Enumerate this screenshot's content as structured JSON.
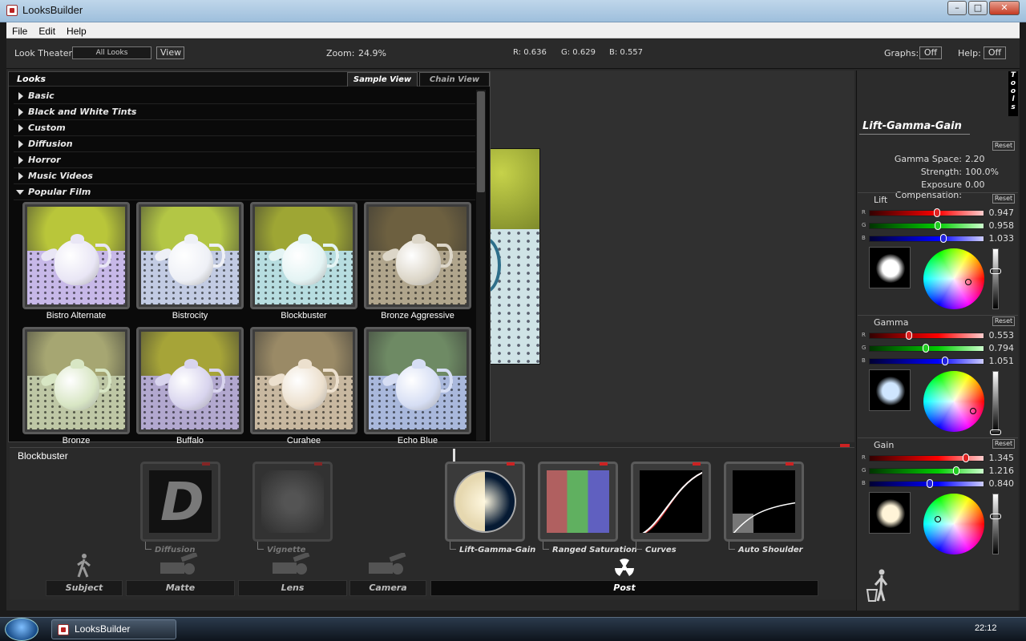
{
  "window": {
    "title": "LooksBuilder",
    "min": "–",
    "max": "□",
    "close": "✕"
  },
  "menu": [
    "File",
    "Edit",
    "Help"
  ],
  "toolbar": {
    "look_theater_label": "Look Theater:",
    "look_theater_value": "All Looks",
    "view_button": "View",
    "zoom_label": "Zoom:",
    "zoom_value": "24.9%",
    "r_readout": "R: 0.636",
    "g_readout": "G: 0.629",
    "b_readout": "B: 0.557",
    "graphs_label": "Graphs:",
    "graphs_value": "Off",
    "help_label": "Help:",
    "help_value": "Off"
  },
  "looks": {
    "title": "Looks",
    "tabs": [
      "Sample View",
      "Chain View"
    ],
    "categories": [
      "Basic",
      "Black and White Tints",
      "Custom",
      "Diffusion",
      "Horror",
      "Music Videos",
      "Popular Film"
    ],
    "thumbnails": [
      {
        "label": "Bistro Alternate",
        "wall": "#b9c63a",
        "table": "#c7b8e8",
        "pot": "#e9e6f5",
        "dots": "#5a4a6a"
      },
      {
        "label": "Bistrocity",
        "wall": "#b3c645",
        "table": "#c2cbe3",
        "pot": "#eef0f6",
        "dots": "#4a4a5a"
      },
      {
        "label": "Blockbuster",
        "wall": "#9ea634",
        "table": "#b7dde0",
        "pot": "#e4f4f4",
        "dots": "#2f3e44"
      },
      {
        "label": "Bronze Aggressive",
        "wall": "#6d6040",
        "table": "#b0a58c",
        "pot": "#dcd6c8",
        "dots": "#2a2418"
      },
      {
        "label": "Bronze",
        "wall": "#a6a672",
        "table": "#bec7a5",
        "pot": "#d8e6c4",
        "dots": "#5a5a48"
      },
      {
        "label": "Buffalo",
        "wall": "#a6a438",
        "table": "#b2a8cf",
        "pot": "#d8d4ee",
        "dots": "#3d365a"
      },
      {
        "label": "Curahee",
        "wall": "#9a8a66",
        "table": "#c8b8a0",
        "pot": "#ece0ce",
        "dots": "#3a3024"
      },
      {
        "label": "Echo Blue",
        "wall": "#6e8a64",
        "table": "#a9b8dc",
        "pot": "#d6def4",
        "dots": "#2a3a5a"
      }
    ]
  },
  "chain": {
    "current_look": "Blockbuster",
    "slots": [
      {
        "label": "Diffusion",
        "glyph": "D",
        "dim": true
      },
      {
        "label": "Vignette",
        "dim": true
      },
      {
        "label": "Lift-Gamma-Gain",
        "dim": false
      },
      {
        "label": "Ranged Saturation",
        "dim": false
      },
      {
        "label": "Curves",
        "dim": false
      },
      {
        "label": "Auto Shoulder",
        "dim": false
      }
    ],
    "categories": [
      "Subject",
      "Matte",
      "Lens",
      "Camera",
      "Post"
    ]
  },
  "tools": {
    "tab_label": "Tools",
    "title": "Lift-Gamma-Gain",
    "reset": "Reset",
    "params": [
      {
        "label": "Gamma Space:",
        "value": "2.20"
      },
      {
        "label": "Strength:",
        "value": "100.0%"
      },
      {
        "label": "Exposure Compensation:",
        "value": "0.00"
      }
    ],
    "sections": [
      {
        "title": "Lift",
        "r": 0.947,
        "g": 0.958,
        "b": 1.033,
        "r_text": "0.947",
        "g_text": "0.958",
        "b_text": "1.033",
        "preview": "#ffffff"
      },
      {
        "title": "Gamma",
        "r": 0.553,
        "g": 0.794,
        "b": 1.051,
        "r_text": "0.553",
        "g_text": "0.794",
        "b_text": "1.051",
        "preview": "#cfe6ff"
      },
      {
        "title": "Gain",
        "r": 1.345,
        "g": 1.216,
        "b": 0.84,
        "r_text": "1.345",
        "g_text": "1.216",
        "b_text": "0.840",
        "preview": "#fff4d8"
      }
    ],
    "channels": [
      "R",
      "G",
      "B"
    ]
  },
  "taskbar": {
    "app_label": "LooksBuilder",
    "clock": "22:12"
  },
  "colors": {
    "accent_red": "#cc2222",
    "panel": "#2c2c2c",
    "titlebar": "#9ebfdc"
  }
}
